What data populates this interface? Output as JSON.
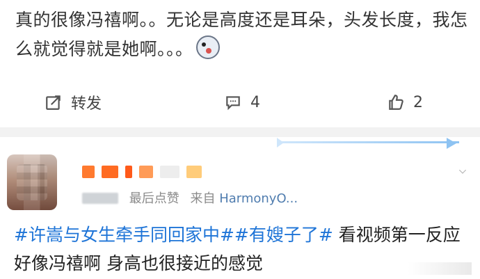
{
  "post1": {
    "text": "真的很像冯禧啊。。无论是高度还是耳朵，头发长度，我怎么就觉得就是她啊。。。",
    "actions": {
      "repost_label": "转发",
      "comment_count": "4",
      "like_count": "2"
    }
  },
  "post2": {
    "meta": {
      "last_liked": "最后点赞",
      "from_prefix": "来自",
      "source": "HarmonyO..."
    },
    "hashtag1": "#许嵩与女生牵手同回家中#",
    "hashtag2": "#有嫂子了#",
    "text": "看视频第一反应 好像冯禧啊 身高也很接近的感觉"
  },
  "colors": {
    "hashtag": "#1e74d7",
    "meta": "#8a8a8a",
    "source_link": "#507daf",
    "text": "#333333"
  }
}
